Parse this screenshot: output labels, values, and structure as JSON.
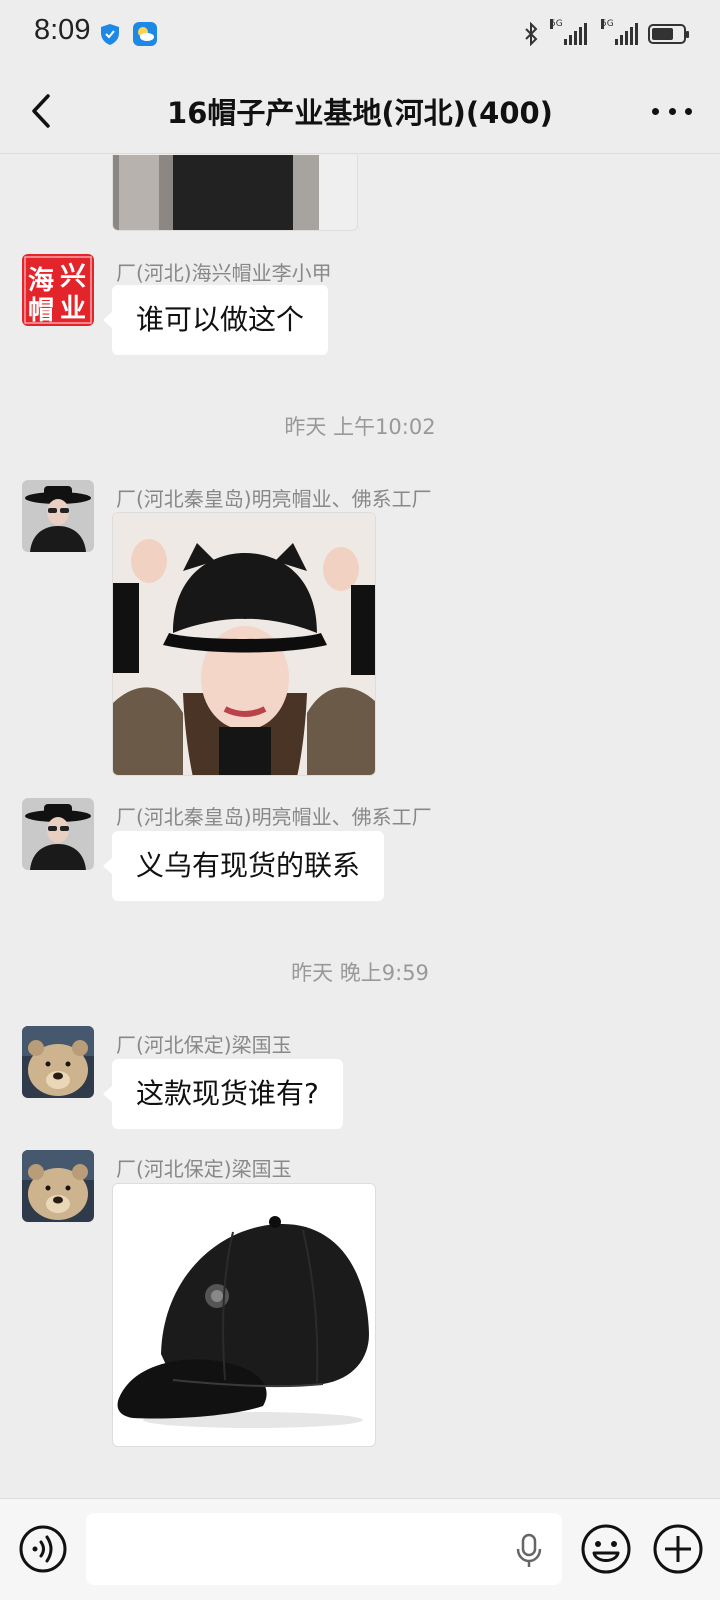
{
  "status_bar": {
    "time": "8:09",
    "network_1": "5G",
    "network_2": "5G",
    "battery_level_percent": 70,
    "icons": [
      "shield-app-icon",
      "weather-app-icon",
      "bluetooth-icon",
      "signal-icon",
      "signal-icon",
      "battery-icon"
    ]
  },
  "header": {
    "title": "16帽子产业基地(河北)(400)",
    "back_icon": "chevron-left-icon",
    "more_icon": "more-dots-icon"
  },
  "messages": [
    {
      "type": "image",
      "sender": "",
      "image": "fur-hat-photo-partial"
    },
    {
      "type": "text",
      "sender": "厂(河北)海兴帽业李小甲",
      "avatar_text": [
        "海",
        "兴",
        "帽",
        "业"
      ],
      "text": "谁可以做这个"
    },
    {
      "type": "timestamp",
      "text": "昨天 上午10:02"
    },
    {
      "type": "image",
      "sender": "厂(河北秦皇岛)明亮帽业、佛系工厂",
      "avatar": "woman-in-black-hat-avatar",
      "image": "woman-wearing-black-cat-ear-cap-photo"
    },
    {
      "type": "text",
      "sender": "厂(河北秦皇岛)明亮帽业、佛系工厂",
      "avatar": "woman-in-black-hat-avatar",
      "text": "义乌有现货的联系"
    },
    {
      "type": "timestamp",
      "text": "昨天 晚上9:59"
    },
    {
      "type": "text",
      "sender": "厂(河北保定)梁国玉",
      "avatar": "bear-avatar",
      "text": "这款现货谁有?"
    },
    {
      "type": "image",
      "sender": "厂(河北保定)梁国玉",
      "avatar": "bear-avatar",
      "image": "black-baseball-cap-photo"
    }
  ],
  "input_bar": {
    "voice_icon": "voice-mode-icon",
    "mic_icon": "microphone-icon",
    "emoji_icon": "emoji-icon",
    "plus_icon": "plus-icon",
    "input_value": ""
  },
  "colors": {
    "background": "#ededed",
    "bubble": "#ffffff",
    "sender_text": "#888888",
    "timestamp_text": "#999999",
    "seal_red": "#e3242b"
  }
}
